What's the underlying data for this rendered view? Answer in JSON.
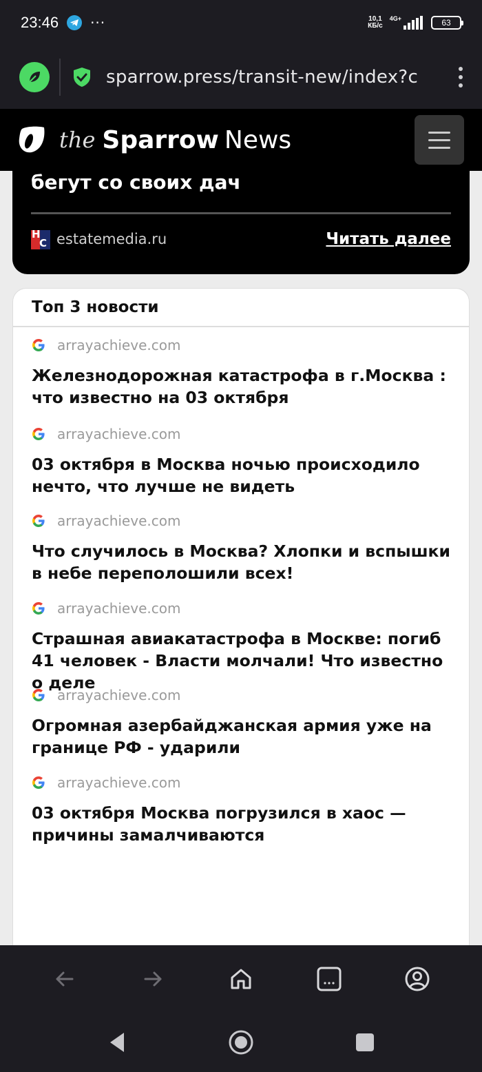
{
  "status_bar": {
    "time": "23:46",
    "dots": "···",
    "net_speed": "10,1",
    "net_unit": "КБ/с",
    "net_type": "4G+",
    "battery": "63"
  },
  "browser": {
    "url": "sparrow.press/transit-new/index?c"
  },
  "site": {
    "brand_the": "the",
    "brand_sparrow": "Sparrow",
    "brand_news": "News"
  },
  "prev_article": {
    "title_tail": "бегут со своих дач",
    "source": "estatemedia.ru",
    "read_more": "Читать далее"
  },
  "top_news": {
    "title": "Топ 3 новости",
    "items": [
      {
        "source": "arrayachieve.com",
        "headline": "Железнодорожная катастрофа в г.Москва : что известно на 03 октября"
      },
      {
        "source": "arrayachieve.com",
        "headline": "03 октября в Москва ночью происходило нечто, что лучше не видеть"
      },
      {
        "source": "arrayachieve.com",
        "headline": "Что случилось в Москва? Хлопки и вспышки в небе переполошили всех!"
      },
      {
        "source": "arrayachieve.com",
        "headline": "Страшная авиакатастрофа в Москве: погиб 41 человек - Власти молчали! Что известно о деле"
      },
      {
        "source": "arrayachieve.com",
        "headline": "Огромная азербайджанская армия уже на границе РФ - ударили"
      },
      {
        "source": "arrayachieve.com",
        "headline": "03 октября Москва погрузился в хаос — причины замалчиваются"
      }
    ]
  },
  "icons": {
    "telegram": "telegram-icon",
    "leaf": "leaf-icon",
    "shield": "shield-check-icon",
    "menu": "hamburger-icon",
    "google": "google-icon",
    "back": "arrow-left-icon",
    "forward": "arrow-right-icon",
    "home": "home-icon",
    "tabs": "tabs-icon",
    "profile": "profile-icon"
  },
  "colors": {
    "leaf_green": "#4cd964",
    "shield_green": "#4cd964",
    "chrome_bg": "#1d1c22"
  }
}
